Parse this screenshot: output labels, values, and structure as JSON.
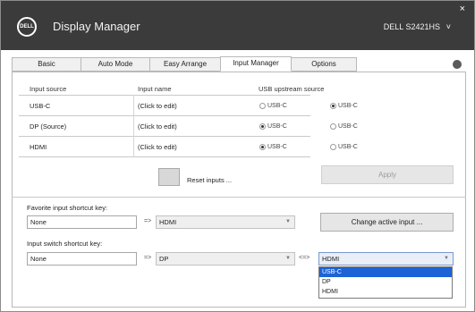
{
  "window": {
    "logo_text": "DELL",
    "title": "Display Manager",
    "monitor": "DELL S2421HS",
    "chevron": "˅",
    "close": "×"
  },
  "tabs": [
    {
      "label": "Basic"
    },
    {
      "label": "Auto Mode"
    },
    {
      "label": "Easy Arrange"
    },
    {
      "label": "Input Manager",
      "active": true
    },
    {
      "label": "Options"
    }
  ],
  "inputs_table": {
    "headers": {
      "input": "Input source",
      "name": "Input name",
      "usb": "USB upstream source"
    },
    "rows": [
      {
        "input": "USB-C",
        "name": "(Click to edit)",
        "usb_a": "USB-C",
        "usb_b": "USB-C",
        "selected": "b"
      },
      {
        "input": "DP (Source)",
        "name": "(Click to edit)",
        "usb_a": "USB-C",
        "usb_b": "USB-C",
        "selected": "a"
      },
      {
        "input": "HDMI",
        "name": "(Click to edit)",
        "usb_a": "USB-C",
        "usb_b": "USB-C",
        "selected": "a"
      }
    ]
  },
  "actions": {
    "factory_reset": "Reset inputs ...",
    "apply": "Apply"
  },
  "favorite": {
    "label": "Favorite input shortcut key:",
    "key_value": "None",
    "arrow": "=>",
    "input_value": "HDMI",
    "button": "Change active input ..."
  },
  "switch_shortcut": {
    "label": "Input switch shortcut key:",
    "key_value": "None",
    "arrow": "=>",
    "input_a": "DP",
    "between": "<=>",
    "input_b": "HDMI",
    "options": [
      "USB-C",
      "DP",
      "HDMI"
    ],
    "highlighted": "USB-C"
  },
  "colors": {
    "titlebar": "#3b3b3b",
    "highlight": "#1e63d5"
  }
}
